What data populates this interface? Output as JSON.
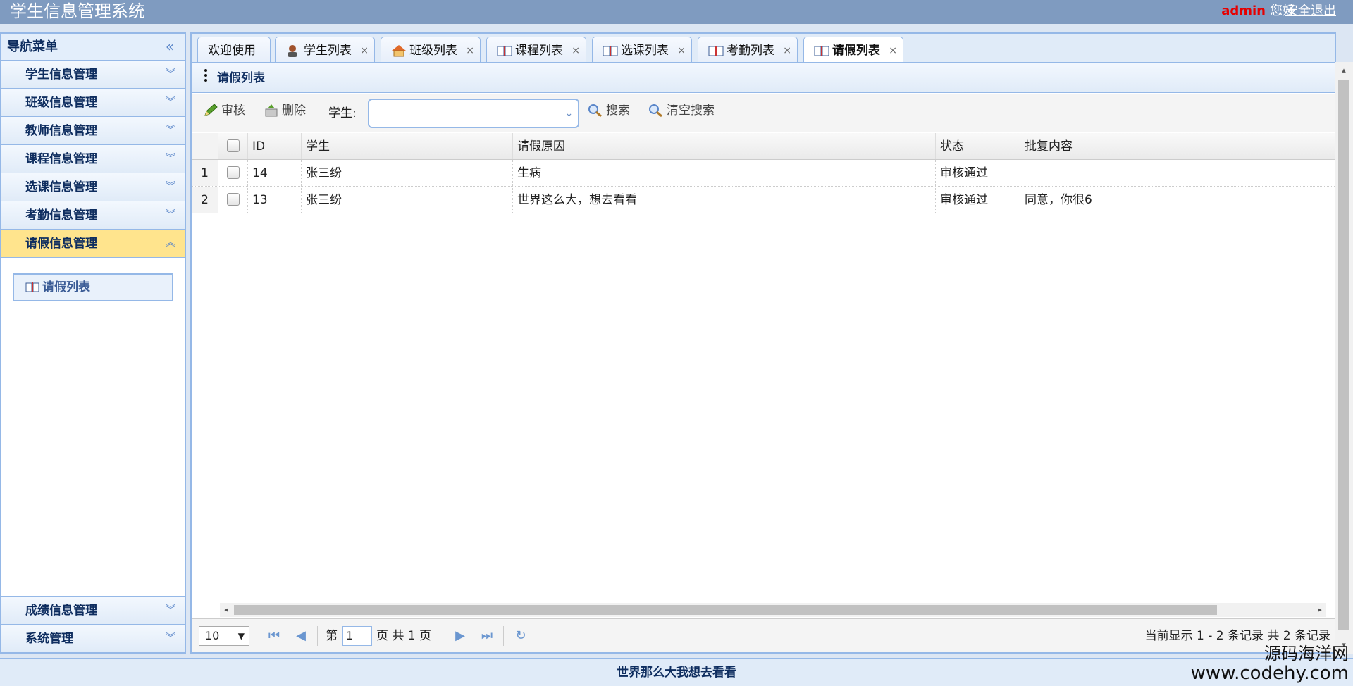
{
  "header": {
    "title": "学生信息管理系统",
    "user_name": "admin",
    "greeting": "您好",
    "logout": "安全退出"
  },
  "sidebar": {
    "title": "导航菜单",
    "items": [
      {
        "label": "学生信息管理"
      },
      {
        "label": "班级信息管理"
      },
      {
        "label": "教师信息管理"
      },
      {
        "label": "课程信息管理"
      },
      {
        "label": "选课信息管理"
      },
      {
        "label": "考勤信息管理"
      },
      {
        "label": "请假信息管理"
      }
    ],
    "active_sub": "请假列表",
    "bottom_items": [
      {
        "label": "成绩信息管理"
      },
      {
        "label": "系统管理"
      }
    ]
  },
  "tabs": [
    {
      "label": "欢迎使用"
    },
    {
      "label": "学生列表"
    },
    {
      "label": "班级列表"
    },
    {
      "label": "课程列表"
    },
    {
      "label": "选课列表"
    },
    {
      "label": "考勤列表"
    },
    {
      "label": "请假列表"
    }
  ],
  "panel": {
    "title": "请假列表"
  },
  "toolbar": {
    "audit": "审核",
    "delete": "删除",
    "student_label": "学生:",
    "student_value": "",
    "search": "搜索",
    "clear": "清空搜索"
  },
  "grid": {
    "columns": [
      "ID",
      "学生",
      "请假原因",
      "状态",
      "批复内容"
    ],
    "rows": [
      {
        "num": "1",
        "id": "14",
        "student": "张三纷",
        "reason": "生病",
        "status": "审核通过",
        "reply": ""
      },
      {
        "num": "2",
        "id": "13",
        "student": "张三纷",
        "reason": "世界这么大，想去看看",
        "status": "审核通过",
        "reply": "同意，你很6"
      }
    ]
  },
  "pager": {
    "page_size": "10",
    "page_prefix": "第",
    "page_value": "1",
    "page_suffix": "页 共 1 页",
    "info": "当前显示 1 - 2 条记录 共 2 条记录"
  },
  "footer": {
    "text": "世界那么大我想去看看"
  },
  "watermark": {
    "line1": "源码海洋网",
    "line2": "www.codehy.com"
  },
  "colors": {
    "header_bg": "#7f9bc0",
    "border": "#95b8e7",
    "active_menu": "#ffe48d",
    "admin_name": "#e60000"
  }
}
